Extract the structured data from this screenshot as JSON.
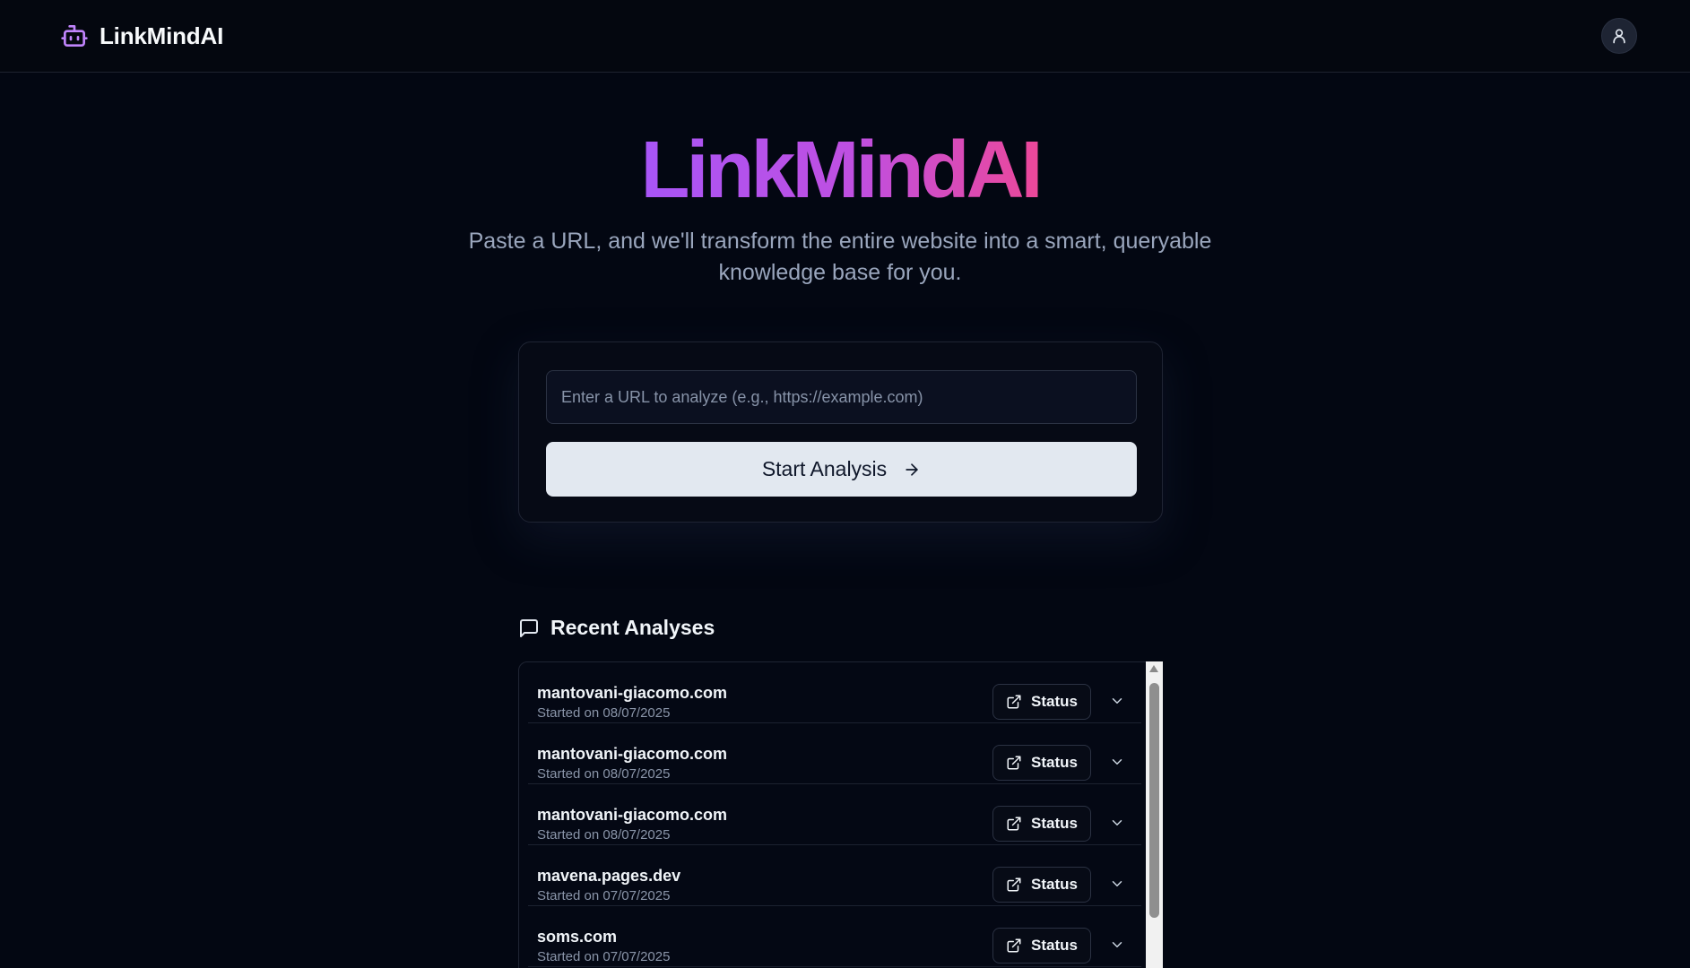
{
  "header": {
    "brand": "LinkMindAI",
    "brand_icon": "robot-icon",
    "user_icon": "user-icon"
  },
  "hero": {
    "title": "LinkMindAI",
    "subtitle": "Paste a URL, and we'll transform the entire website into a smart, queryable knowledge base for you."
  },
  "analyze": {
    "placeholder": "Enter a URL to analyze (e.g., https://example.com)",
    "value": "",
    "button_label": "Start Analysis",
    "button_icon": "arrow-right-icon"
  },
  "recent": {
    "heading": "Recent Analyses",
    "heading_icon": "message-square-icon",
    "items": [
      {
        "domain": "mantovani-giacomo.com",
        "date": "Started on 08/07/2025",
        "status_label": "Status"
      },
      {
        "domain": "mantovani-giacomo.com",
        "date": "Started on 08/07/2025",
        "status_label": "Status"
      },
      {
        "domain": "mantovani-giacomo.com",
        "date": "Started on 08/07/2025",
        "status_label": "Status"
      },
      {
        "domain": "mavena.pages.dev",
        "date": "Started on 07/07/2025",
        "status_label": "Status"
      },
      {
        "domain": "soms.com",
        "date": "Started on 07/07/2025",
        "status_label": "Status"
      }
    ]
  },
  "colors": {
    "background": "#030712",
    "accent_purple": "#a855f7",
    "accent_pink": "#ec4899",
    "button_bg": "#e2e8f0"
  }
}
